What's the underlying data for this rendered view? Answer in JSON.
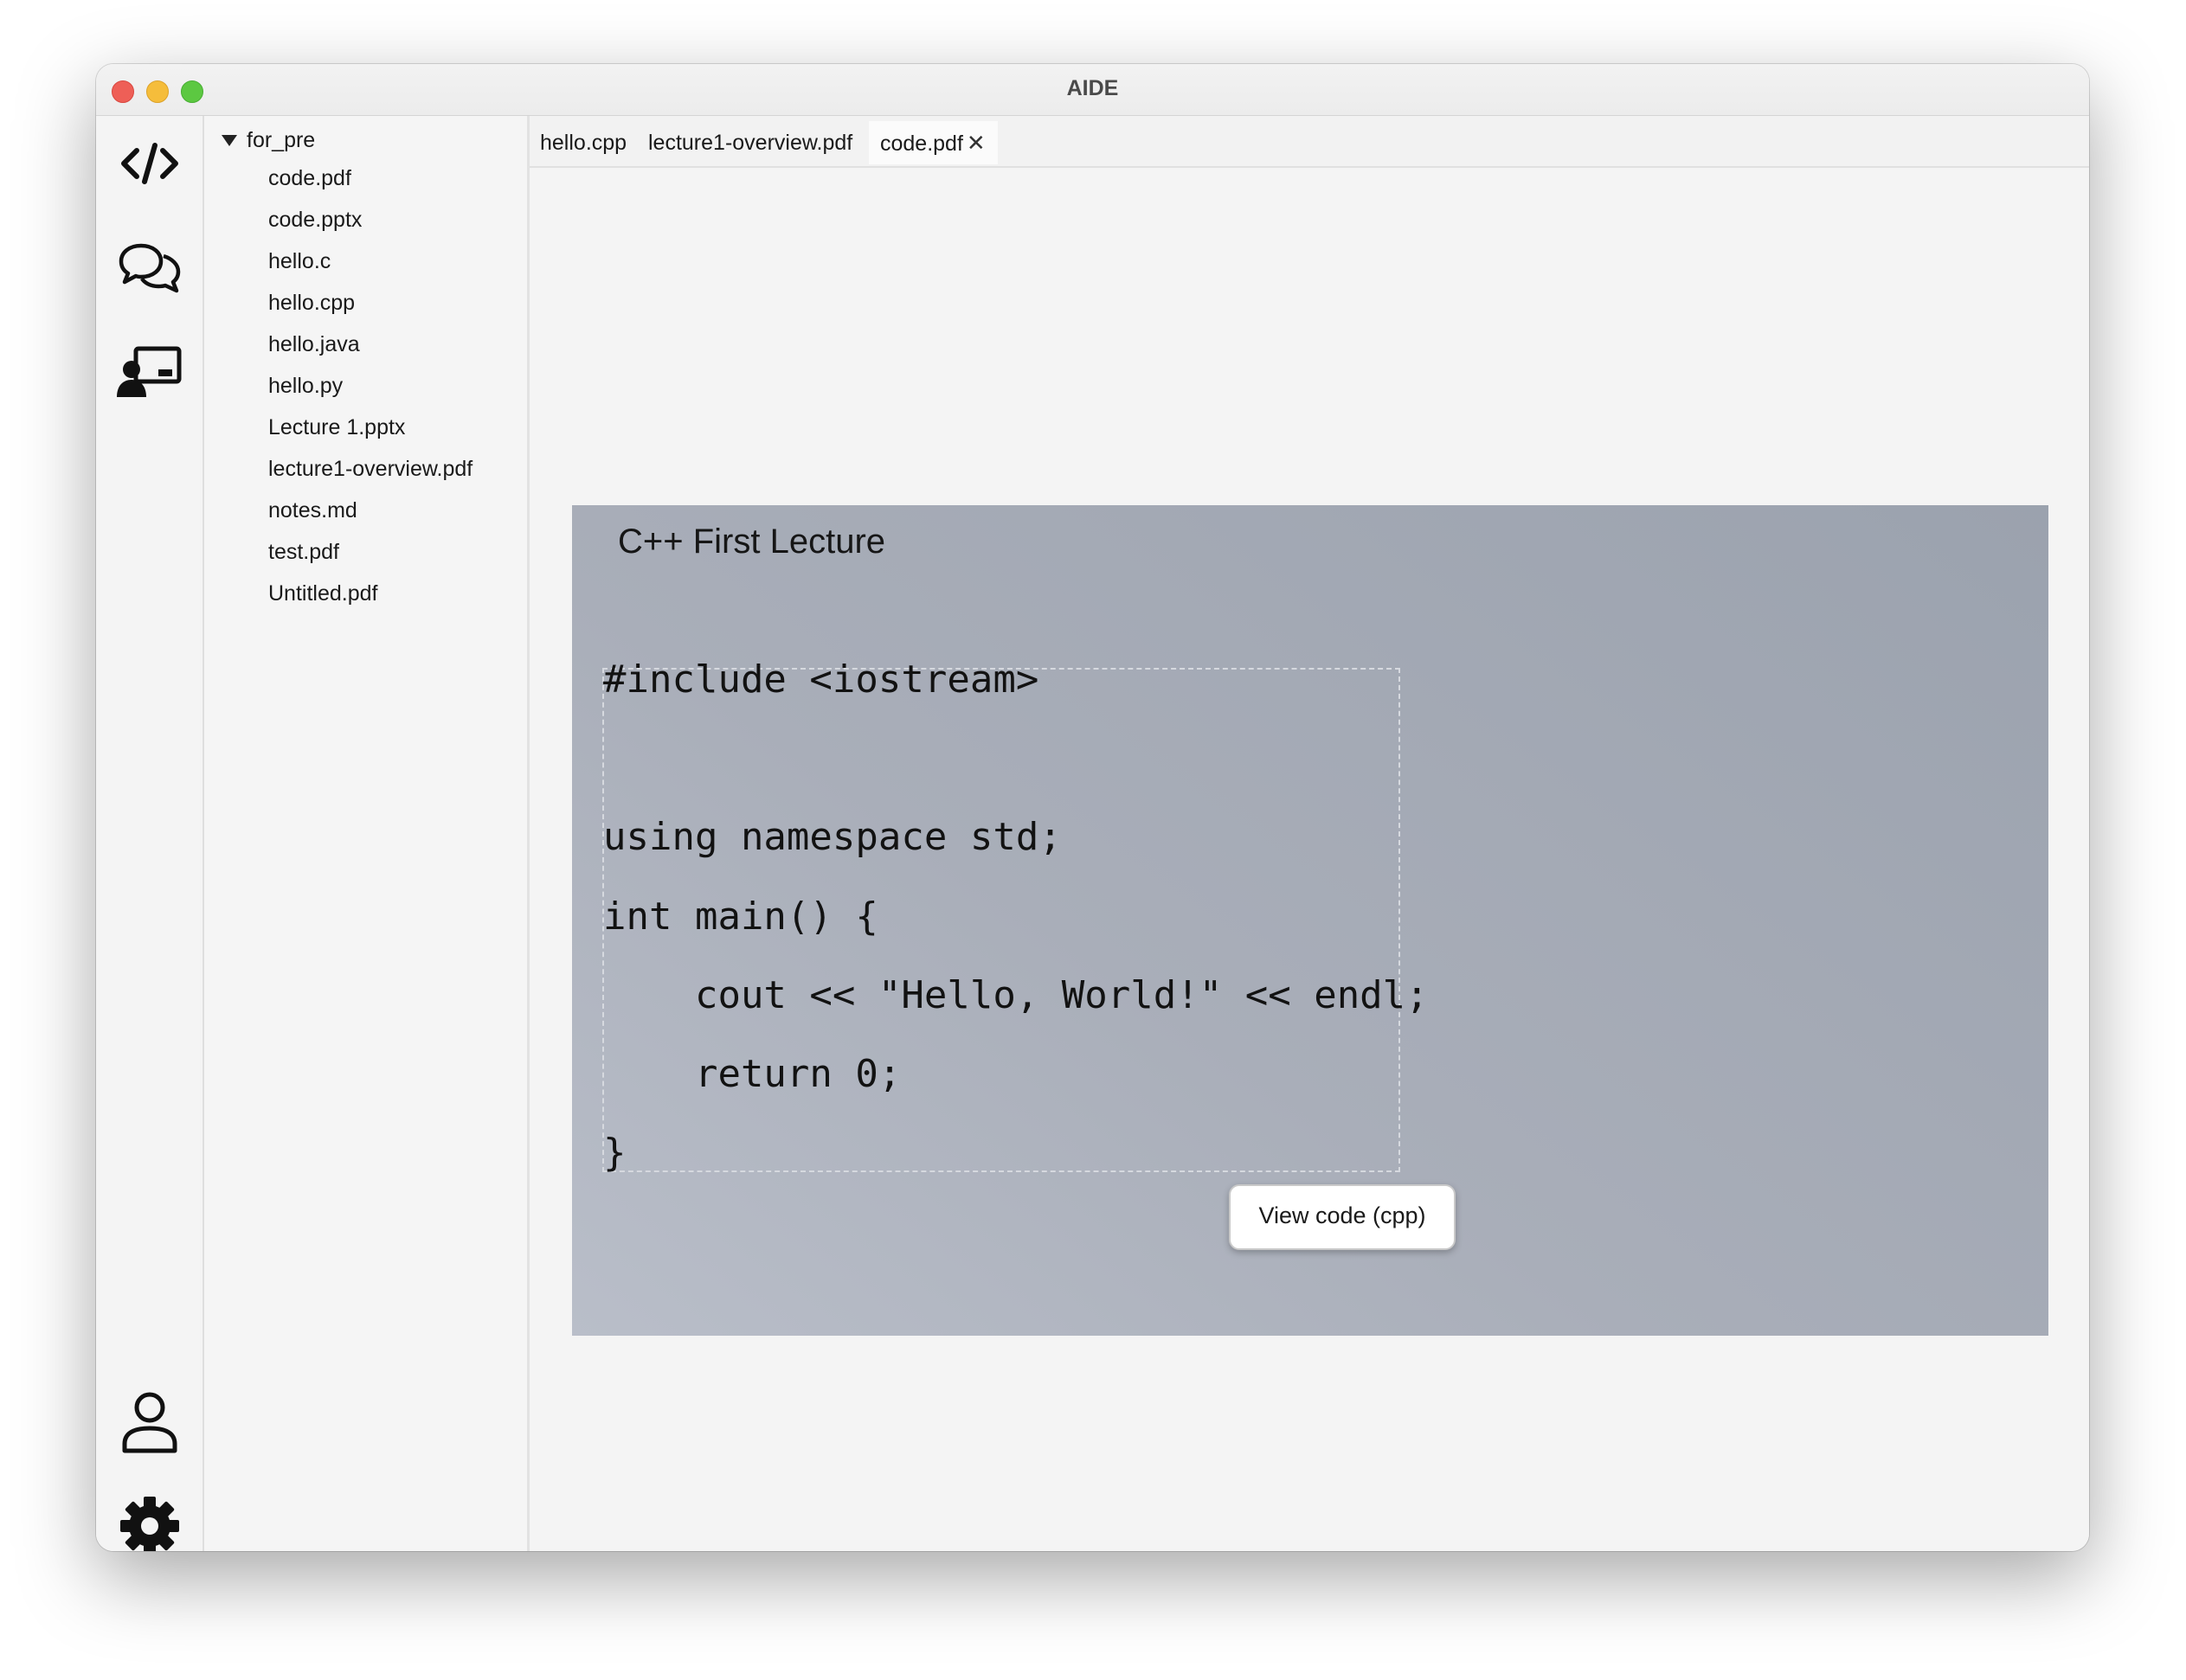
{
  "window": {
    "title": "AIDE"
  },
  "activity_bar": {
    "top_icons": [
      "code-icon",
      "chat-icon",
      "presentation-icon"
    ],
    "bottom_icons": [
      "user-icon",
      "settings-gear-icon"
    ]
  },
  "explorer": {
    "folder": {
      "name": "for_pre",
      "expanded": true
    },
    "files": [
      "code.pdf",
      "code.pptx",
      "hello.c",
      "hello.cpp",
      "hello.java",
      "hello.py",
      "Lecture 1.pptx",
      "lecture1-overview.pdf",
      "notes.md",
      "test.pdf",
      "Untitled.pdf"
    ]
  },
  "tabs": [
    {
      "label": "hello.cpp",
      "active": false
    },
    {
      "label": "lecture1-overview.pdf",
      "active": false
    },
    {
      "label": "code.pdf",
      "active": true,
      "close_glyph": "✕"
    }
  ],
  "slide": {
    "title": "C++ First Lecture",
    "code_lines": [
      "#include <iostream>",
      "using namespace std;",
      "int main() {",
      "    cout << \"Hello, World!\" << endl;",
      "    return 0;",
      "}"
    ],
    "view_code_button": "View code (cpp)"
  },
  "colors": {
    "window_bg": "#f4f4f4",
    "slide_gradient_start": "#b9bec9",
    "slide_gradient_end": "#9ba2ae",
    "traffic_close": "#ee5f57",
    "traffic_min": "#f5bd3b",
    "traffic_max": "#5cc841"
  }
}
